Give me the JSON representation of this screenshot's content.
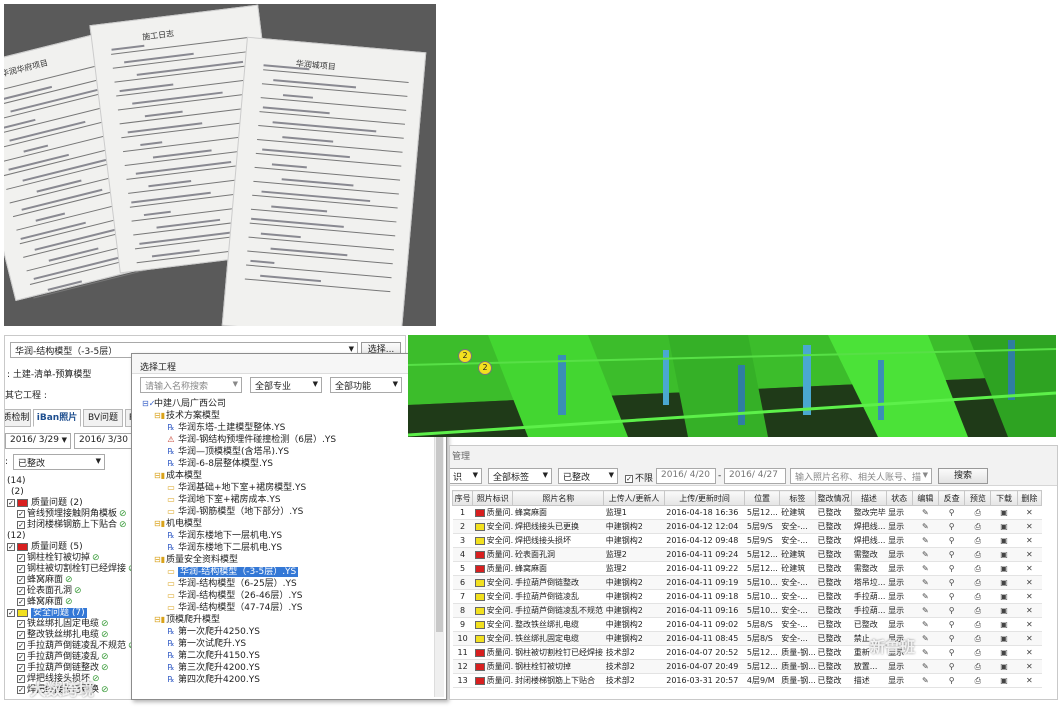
{
  "photo": {
    "sheet_titles": [
      "华润华府项目",
      "施工日志",
      "华润城项目"
    ]
  },
  "left_panel": {
    "model_select": "华润-结构模型（-3-5层）",
    "select_button": "选择...",
    "project_line": "土建-清单-预算模型",
    "other_project": "其它工程",
    "tabs": [
      "质检制",
      "iBan照片",
      "BV问题",
      "R"
    ],
    "date_from": "2016/ 3/29",
    "date_to": "2016/ 3/30",
    "status_filter": "已整改",
    "tree": [
      {
        "text": "(14)",
        "swatch": "",
        "check": false,
        "indent": 0
      },
      {
        "text": "(2)",
        "swatch": "",
        "check": false,
        "indent": 4
      },
      {
        "text": "质量问题 (2)",
        "swatch": "#d81f1f",
        "check": true,
        "indent": 0
      },
      {
        "text": "管线预埋接触阴角模板",
        "swatch": "",
        "check": true,
        "indent": 10,
        "ok": true
      },
      {
        "text": "封闭楼梯钢筋上下贴合",
        "swatch": "",
        "check": true,
        "indent": 10,
        "ok": true
      },
      {
        "text": "(12)",
        "swatch": "",
        "check": false,
        "indent": 0
      },
      {
        "text": "质量问题 (5)",
        "swatch": "#d81f1f",
        "check": true,
        "indent": 0
      },
      {
        "text": "钢柱栓钉被切掉",
        "swatch": "",
        "check": true,
        "indent": 10,
        "ok": true
      },
      {
        "text": "钢柱被切割栓钉已经焊接",
        "swatch": "",
        "check": true,
        "indent": 10,
        "ok": true
      },
      {
        "text": "蜂窝麻面",
        "swatch": "",
        "check": true,
        "indent": 10,
        "ok": true
      },
      {
        "text": "砼表面孔洞",
        "swatch": "",
        "check": true,
        "indent": 10,
        "ok": true
      },
      {
        "text": "蜂窝麻面",
        "swatch": "",
        "check": true,
        "indent": 10,
        "ok": true
      },
      {
        "text": "安全问题 (7)",
        "swatch": "#f2e01f",
        "check": true,
        "indent": 0,
        "selected": true
      },
      {
        "text": "铁丝绑扎固定电缆",
        "swatch": "",
        "check": true,
        "indent": 10,
        "ok": true
      },
      {
        "text": "整改铁丝绑扎电缆",
        "swatch": "",
        "check": true,
        "indent": 10,
        "ok": true
      },
      {
        "text": "手拉葫芦倒链凌乱不规范",
        "swatch": "",
        "check": true,
        "indent": 10,
        "ok": true
      },
      {
        "text": "手拉葫芦倒链凌乱",
        "swatch": "",
        "check": true,
        "indent": 10,
        "ok": true
      },
      {
        "text": "手拉葫芦倒链整改",
        "swatch": "",
        "check": true,
        "indent": 10,
        "ok": true
      },
      {
        "text": "焊把线接头损坏",
        "swatch": "",
        "check": true,
        "indent": 10,
        "ok": true
      },
      {
        "text": "焊把线接头已更换",
        "swatch": "",
        "check": true,
        "indent": 10,
        "ok": true
      }
    ]
  },
  "dialog": {
    "title": "选择工程",
    "search_placeholder": "请输入名称搜索",
    "specialty": "全部专业",
    "function": "全部功能",
    "nodes": [
      {
        "text": "中建八局广西公司",
        "level": 0,
        "icon": "root"
      },
      {
        "text": "技术方案模型",
        "level": 1,
        "icon": "folder"
      },
      {
        "text": "华润东塔-土建模型整体.YS",
        "level": 2,
        "icon": "file"
      },
      {
        "text": "华润-钢结构预埋件碰撞检测（6层）.YS",
        "level": 2,
        "icon": "filer"
      },
      {
        "text": "华润—顶模模型(含塔吊).YS",
        "level": 2,
        "icon": "file"
      },
      {
        "text": "华润-6-8层整体模型.YS",
        "level": 2,
        "icon": "file"
      },
      {
        "text": "成本模型",
        "level": 1,
        "icon": "folder"
      },
      {
        "text": "华润基础+地下室+裙房模型.YS",
        "level": 2,
        "icon": "fileo"
      },
      {
        "text": "华润地下室+裙房成本.YS",
        "level": 2,
        "icon": "fileo"
      },
      {
        "text": "华润-钢筋模型（地下部分）.YS",
        "level": 2,
        "icon": "fileo"
      },
      {
        "text": "机电模型",
        "level": 1,
        "icon": "folder"
      },
      {
        "text": "华润东楼地下一层机电.YS",
        "level": 2,
        "icon": "file"
      },
      {
        "text": "华润东楼地下二层机电.YS",
        "level": 2,
        "icon": "file"
      },
      {
        "text": "质量安全资料模型",
        "level": 1,
        "icon": "folder"
      },
      {
        "text": "华润-结构模型（-3-5层）.YS",
        "level": 2,
        "icon": "fileo",
        "selected": true
      },
      {
        "text": "华润-结构模型（6-25层）.YS",
        "level": 2,
        "icon": "fileo"
      },
      {
        "text": "华润-结构模型（26-46层）.YS",
        "level": 2,
        "icon": "fileo"
      },
      {
        "text": "华润-结构模型（47-74层）.YS",
        "level": 2,
        "icon": "fileo"
      },
      {
        "text": "顶模爬升模型",
        "level": 1,
        "icon": "folder"
      },
      {
        "text": "第一次爬升4250.YS",
        "level": 2,
        "icon": "file"
      },
      {
        "text": "第一次试爬升.YS",
        "level": 2,
        "icon": "file"
      },
      {
        "text": "第二次爬升4150.YS",
        "level": 2,
        "icon": "file"
      },
      {
        "text": "第三次爬升4200.YS",
        "level": 2,
        "icon": "file"
      },
      {
        "text": "第四次爬升4200.YS",
        "level": 2,
        "icon": "file"
      }
    ]
  },
  "model_view": {
    "markers": [
      "2",
      "2"
    ]
  },
  "table_panel": {
    "title": "管理",
    "filter_a": "识",
    "filter_tag": "全部标签",
    "filter_status": "已整改",
    "unlimited_label": "不限",
    "date_from": "2016/ 4/20",
    "date_to": "2016/ 4/27",
    "search_placeholder": "输入照片名称、相关人账号、描",
    "search_button": "搜索",
    "columns": [
      "序号",
      "照片标识",
      "照片名称",
      "上传人/更新人",
      "上传/更新时间",
      "位置",
      "标签",
      "整改情况",
      "描述",
      "状态",
      "编辑",
      "反查",
      "预览",
      "下载",
      "删除"
    ],
    "rows": [
      {
        "no": "1",
        "color": "#d81f1f",
        "mark": "质量问...",
        "name": "蜂窝麻面",
        "uploader": "监理1",
        "time": "2016-04-18 16:36",
        "loc": "5层12...",
        "tag": "砼建筑",
        "fix": "已整改",
        "desc": "整改完毕",
        "state": "显示"
      },
      {
        "no": "2",
        "color": "#f2e01f",
        "mark": "安全问...",
        "name": "焊把线接头已更换",
        "uploader": "中建钢构2",
        "time": "2016-04-12 12:04",
        "loc": "5层9/S",
        "tag": "安全-...",
        "fix": "已整改",
        "desc": "焊把线...",
        "state": "显示"
      },
      {
        "no": "3",
        "color": "#f2e01f",
        "mark": "安全问...",
        "name": "焊把线接头损坏",
        "uploader": "中建钢构2",
        "time": "2016-04-12 09:48",
        "loc": "5层9/S",
        "tag": "安全-...",
        "fix": "已整改",
        "desc": "焊把线...",
        "state": "显示"
      },
      {
        "no": "4",
        "color": "#d81f1f",
        "mark": "质量问...",
        "name": "砼表面孔洞",
        "uploader": "监理2",
        "time": "2016-04-11 09:24",
        "loc": "5层12...",
        "tag": "砼建筑",
        "fix": "已整改",
        "desc": "需整改",
        "state": "显示"
      },
      {
        "no": "5",
        "color": "#d81f1f",
        "mark": "质量问...",
        "name": "蜂窝麻面",
        "uploader": "监理2",
        "time": "2016-04-11 09:22",
        "loc": "5层12...",
        "tag": "砼建筑",
        "fix": "已整改",
        "desc": "需整改",
        "state": "显示"
      },
      {
        "no": "6",
        "color": "#f2e01f",
        "mark": "安全问...",
        "name": "手拉葫芦倒链整改",
        "uploader": "中建钢构2",
        "time": "2016-04-11 09:19",
        "loc": "5层10...",
        "tag": "安全-...",
        "fix": "已整改",
        "desc": "塔吊垃...",
        "state": "显示"
      },
      {
        "no": "7",
        "color": "#f2e01f",
        "mark": "安全问...",
        "name": "手拉葫芦倒链凌乱",
        "uploader": "中建钢构2",
        "time": "2016-04-11 09:18",
        "loc": "5层10...",
        "tag": "安全-...",
        "fix": "已整改",
        "desc": "手拉葫...",
        "state": "显示"
      },
      {
        "no": "8",
        "color": "#f2e01f",
        "mark": "安全问...",
        "name": "手拉葫芦倒链凌乱不规范",
        "uploader": "中建钢构2",
        "time": "2016-04-11 09:16",
        "loc": "5层10...",
        "tag": "安全-...",
        "fix": "已整改",
        "desc": "手拉葫...",
        "state": "显示"
      },
      {
        "no": "9",
        "color": "#f2e01f",
        "mark": "安全问...",
        "name": "整改铁丝绑扎电缆",
        "uploader": "中建钢构2",
        "time": "2016-04-11 09:02",
        "loc": "5层8/S",
        "tag": "安全-...",
        "fix": "已整改",
        "desc": "已整改",
        "state": "显示"
      },
      {
        "no": "10",
        "color": "#f2e01f",
        "mark": "安全问...",
        "name": "铁丝绑扎固定电缆",
        "uploader": "中建钢构2",
        "time": "2016-04-11 08:45",
        "loc": "5层8/S",
        "tag": "安全-...",
        "fix": "已整改",
        "desc": "禁止",
        "state": "显示"
      },
      {
        "no": "11",
        "color": "#d81f1f",
        "mark": "质量问...",
        "name": "钢柱被切割栓钉已经焊接",
        "uploader": "技术部2",
        "time": "2016-04-07 20:52",
        "loc": "5层12...",
        "tag": "质量-钢...",
        "fix": "已整改",
        "desc": "重新",
        "state": "显示"
      },
      {
        "no": "12",
        "color": "#d81f1f",
        "mark": "质量问...",
        "name": "钢柱栓钉被切掉",
        "uploader": "技术部2",
        "time": "2016-04-07 20:49",
        "loc": "5层12...",
        "tag": "质量-钢...",
        "fix": "已整改",
        "desc": "放置...",
        "state": "显示"
      },
      {
        "no": "13",
        "color": "#d81f1f",
        "mark": "质量问...",
        "name": "封闭楼梯钢筋上下贴合",
        "uploader": "技术部2",
        "time": "2016-03-31 20:57",
        "loc": "4层9/M",
        "tag": "质量-钢...",
        "fix": "已整改",
        "desc": "描述",
        "state": "显示"
      }
    ]
  },
  "watermarks": {
    "left": "大数跨境",
    "right": "新鲁班"
  }
}
